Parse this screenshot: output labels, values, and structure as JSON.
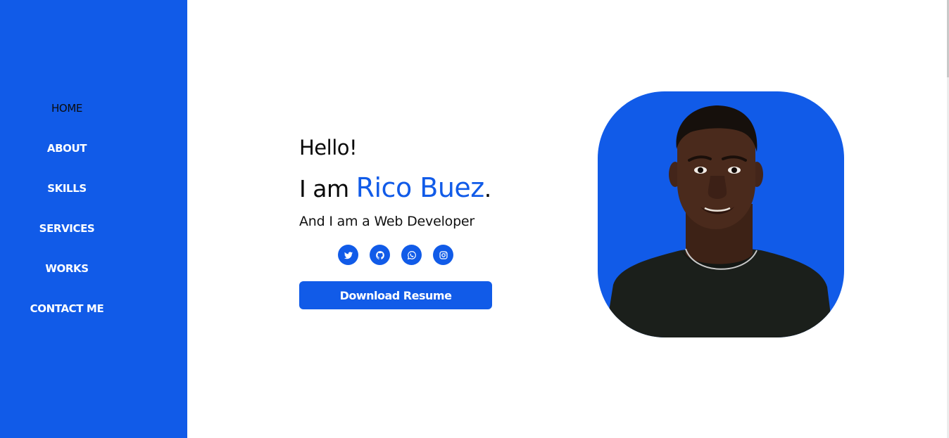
{
  "sidebar": {
    "items": [
      {
        "label": "HOME"
      },
      {
        "label": "ABOUT"
      },
      {
        "label": "SKILLS"
      },
      {
        "label": "SERVICES"
      },
      {
        "label": "WORKS"
      },
      {
        "label": "CONTACT ME"
      }
    ],
    "active_index": 0
  },
  "hero": {
    "greeting": "Hello!",
    "intro_prefix": "I am ",
    "name": "Rico Buez",
    "intro_suffix": ".",
    "role": "And I am a Web Developer",
    "cta_label": "Download Resume"
  },
  "social": [
    {
      "icon": "twitter-icon"
    },
    {
      "icon": "github-icon"
    },
    {
      "icon": "whatsapp-icon"
    },
    {
      "icon": "instagram-icon"
    }
  ],
  "colors": {
    "brand": "#115be8",
    "text": "#0a0a0a",
    "background": "#ffffff",
    "shirt": "#1b1f1b",
    "skin": "#4a2a1c"
  }
}
